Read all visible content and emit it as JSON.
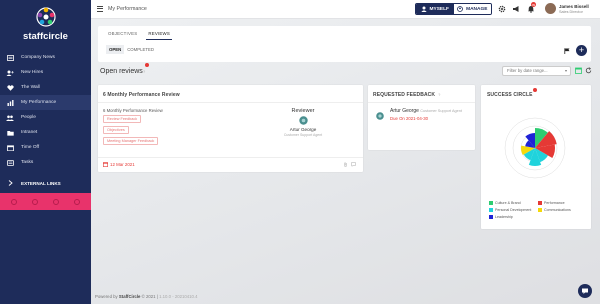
{
  "brand": {
    "name": "staffcircle"
  },
  "sidebar": {
    "items": [
      {
        "label": "Company News",
        "icon": "newspaper-icon"
      },
      {
        "label": "New Hires",
        "icon": "user-plus-icon"
      },
      {
        "label": "The Wall",
        "icon": "heart-icon"
      },
      {
        "label": "My Performance",
        "icon": "chart-icon"
      },
      {
        "label": "People",
        "icon": "people-icon"
      },
      {
        "label": "Intranet",
        "icon": "folder-icon"
      },
      {
        "label": "Time Off",
        "icon": "calendar-icon"
      },
      {
        "label": "Tasks",
        "icon": "tasks-icon"
      }
    ],
    "external_links": "EXTERNAL LINKS",
    "active_index": 3
  },
  "topbar": {
    "title": "My Performance",
    "myself": "MYSELF",
    "manage": "MANAGE",
    "notif_count": "99",
    "user_name": "James Bissell",
    "user_role": "Sales Director"
  },
  "tabs": {
    "primary": [
      "OBJECTIVES",
      "REVIEWS"
    ],
    "primary_selected": "REVIEWS",
    "secondary": [
      "OPEN",
      "COMPLETED"
    ],
    "secondary_selected": "OPEN"
  },
  "open_reviews": {
    "title": "Open reviews",
    "q": "?",
    "filter_placeholder": "Filter by date range..."
  },
  "review_card": {
    "header": "6 Monthly Performance Review",
    "subtitle": "6 Monthly Performance Review",
    "pills": [
      "Review Feedback",
      "Objectives",
      "Meeting Manager Feedback"
    ],
    "reviewer_label": "Reviewer",
    "reviewer_name": "Artur George",
    "reviewer_role": "Customer Support Agent",
    "date": "12 Mar 2021"
  },
  "requested": {
    "header": "REQUESTED FEEDBACK",
    "q": "?",
    "name": "Artur George",
    "role": "Customer Support Agent",
    "due": "Due On 2021-04-30"
  },
  "success": {
    "header": "SUCCESS CIRCLE",
    "legend": [
      {
        "label": "Culture & Brand",
        "color": "#2ecc71"
      },
      {
        "label": "Performance",
        "color": "#e53935"
      },
      {
        "label": "Personal Development",
        "color": "#20d3dc"
      },
      {
        "label": "Communications",
        "color": "#f5d90a"
      },
      {
        "label": "Leadership",
        "color": "#1f23d6"
      }
    ]
  },
  "footer": {
    "prefix": "Powered by",
    "brand": "StaffCircle",
    "copy": "© 2021",
    "version": "1.10.0 - 20210410.4"
  }
}
